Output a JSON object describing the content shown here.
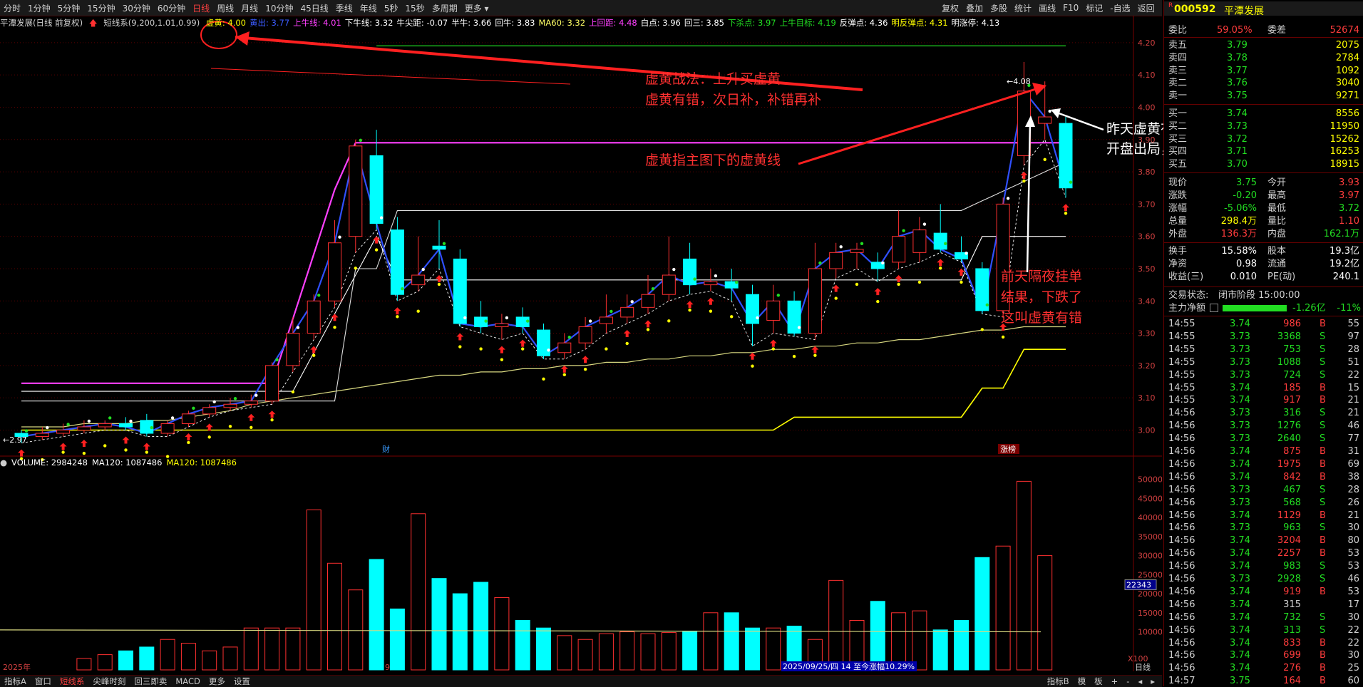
{
  "top_nav": {
    "items": [
      "分时",
      "1分钟",
      "5分钟",
      "15分钟",
      "30分钟",
      "60分钟",
      "日线",
      "周线",
      "月线",
      "10分钟",
      "45日线",
      "季线",
      "年线",
      "5秒",
      "15秒",
      "多周期",
      "更多 ▾"
    ],
    "active": "日线",
    "right_buttons": [
      "复权",
      "叠加",
      "多股",
      "统计",
      "画线",
      "F10",
      "标记",
      "-自选",
      "返回"
    ]
  },
  "chart_header": {
    "stock_title": "平潭发展(日线 前复权)",
    "indicator_name": "短线系(9,200,1.01,0.99)",
    "indicators": [
      {
        "label": "虚黄:",
        "value": "4.00",
        "color": "#ffff00"
      },
      {
        "label": "黄出:",
        "value": "3.77",
        "color": "#3b5bff"
      },
      {
        "label": "上牛线:",
        "value": "4.01",
        "color": "#ff40ff"
      },
      {
        "label": "下牛线:",
        "value": "3.32",
        "color": "#ffffff"
      },
      {
        "label": "牛尖距:",
        "value": "-0.07",
        "color": "#ffffff"
      },
      {
        "label": "半牛:",
        "value": "3.66",
        "color": "#ffffff"
      },
      {
        "label": "回牛:",
        "value": "3.83",
        "color": "#ffffff"
      },
      {
        "label": "MA60:",
        "value": "3.32",
        "color": "#ffff66"
      },
      {
        "label": "上回距:",
        "value": "4.48",
        "color": "#ff40ff"
      },
      {
        "label": "白点:",
        "value": "3.96",
        "color": "#ffffff"
      },
      {
        "label": "回三:",
        "value": "3.85",
        "color": "#ffffff"
      },
      {
        "label": "下杀点:",
        "value": "3.97",
        "color": "#22dd22"
      },
      {
        "label": "上牛目标:",
        "value": "4.19",
        "color": "#22dd22"
      },
      {
        "label": "反弹点:",
        "value": "4.36",
        "color": "#ffffff"
      },
      {
        "label": "明反弹点:",
        "value": "4.31",
        "color": "#ffff00"
      },
      {
        "label": "明涨停:",
        "value": "4.13",
        "color": "#ffffff"
      }
    ],
    "cai_label": "财",
    "zhangting_label": "涨榜"
  },
  "volume_header": {
    "items": [
      {
        "label": "VOLUME:",
        "value": "2984248",
        "color": "#ffffff"
      },
      {
        "label": "MA120:",
        "value": "1087486",
        "color": "#ffffff"
      },
      {
        "label": "MA120:",
        "value": "1087486",
        "color": "#ffff00"
      }
    ],
    "x100": "X100",
    "current_tag": "22343"
  },
  "annotations": {
    "red1_line1": "虚黄战法：上升买虚黄",
    "red1_line2": "虚黄有错，次日补，补错再补",
    "red2": "虚黄指主图下的虚黄线",
    "red3_line1": "前天隔夜挂单",
    "red3_line2": "结果，下跌了",
    "red3_line3": "这叫虚黄有错",
    "white_line1": "昨天虚黄有错，今天先出后补",
    "white_line2": "开盘出局，尾盘接回",
    "start_price": "2.97",
    "peak_price": "4.08"
  },
  "axis": {
    "price_ticks": [
      "4.20",
      "4.10",
      "4.00",
      "3.90",
      "3.80",
      "3.70",
      "3.60",
      "3.50",
      "3.40",
      "3.30",
      "3.20",
      "3.10",
      "3.00"
    ],
    "vol_ticks": [
      "50000",
      "45000",
      "40000",
      "35000",
      "30000",
      "25000",
      "20000",
      "15000",
      "10000"
    ],
    "x_left": "2025年",
    "x_mid": "9",
    "range_info": "2025/09/25/四 14 至今涨幅10.29%",
    "right_tag": "日线"
  },
  "bottom_bar": {
    "items": [
      "指标A",
      "窗口",
      "短线系",
      "尖峰时刻",
      "回三即卖",
      "MACD",
      "更多",
      "设置"
    ],
    "active": "短线系",
    "right_items": [
      "指标B",
      "模",
      "板",
      "+",
      "-",
      "◂",
      "▸"
    ]
  },
  "chart_data": {
    "type": "candlestick",
    "candles": [
      {
        "o": 2.99,
        "c": 2.98,
        "h": 3.0,
        "l": 2.96
      },
      {
        "o": 2.98,
        "c": 2.99,
        "h": 3.01,
        "l": 2.97
      },
      {
        "o": 2.99,
        "c": 3.0,
        "h": 3.02,
        "l": 2.98
      },
      {
        "o": 3.0,
        "c": 3.01,
        "h": 3.03,
        "l": 2.99
      },
      {
        "o": 3.01,
        "c": 3.02,
        "h": 3.03,
        "l": 3.0
      },
      {
        "o": 3.02,
        "c": 3.01,
        "h": 3.04,
        "l": 3.0
      },
      {
        "o": 3.03,
        "c": 2.99,
        "h": 3.05,
        "l": 2.98
      },
      {
        "o": 2.99,
        "c": 3.02,
        "h": 3.03,
        "l": 2.98
      },
      {
        "o": 3.02,
        "c": 3.05,
        "h": 3.06,
        "l": 3.01
      },
      {
        "o": 3.05,
        "c": 3.07,
        "h": 3.08,
        "l": 3.04
      },
      {
        "o": 3.07,
        "c": 3.08,
        "h": 3.1,
        "l": 3.06
      },
      {
        "o": 3.08,
        "c": 3.09,
        "h": 3.11,
        "l": 3.07
      },
      {
        "o": 3.09,
        "c": 3.2,
        "h": 3.21,
        "l": 3.08
      },
      {
        "o": 3.2,
        "c": 3.3,
        "h": 3.35,
        "l": 3.18
      },
      {
        "o": 3.3,
        "c": 3.4,
        "h": 3.42,
        "l": 3.28
      },
      {
        "o": 3.4,
        "c": 3.58,
        "h": 3.65,
        "l": 3.38
      },
      {
        "o": 3.6,
        "c": 3.88,
        "h": 3.9,
        "l": 3.55
      },
      {
        "o": 3.85,
        "c": 3.64,
        "h": 3.93,
        "l": 3.62
      },
      {
        "o": 3.62,
        "c": 3.42,
        "h": 3.66,
        "l": 3.4
      },
      {
        "o": 3.45,
        "c": 3.48,
        "h": 3.6,
        "l": 3.43
      },
      {
        "o": 3.57,
        "c": 3.56,
        "h": 3.65,
        "l": 3.5
      },
      {
        "o": 3.53,
        "c": 3.33,
        "h": 3.56,
        "l": 3.32
      },
      {
        "o": 3.35,
        "c": 3.32,
        "h": 3.4,
        "l": 3.3
      },
      {
        "o": 3.32,
        "c": 3.33,
        "h": 3.36,
        "l": 3.28
      },
      {
        "o": 3.35,
        "c": 3.32,
        "h": 3.38,
        "l": 3.3
      },
      {
        "o": 3.31,
        "c": 3.23,
        "h": 3.33,
        "l": 3.22
      },
      {
        "o": 3.24,
        "c": 3.27,
        "h": 3.3,
        "l": 3.22
      },
      {
        "o": 3.27,
        "c": 3.32,
        "h": 3.35,
        "l": 3.25
      },
      {
        "o": 3.33,
        "c": 3.35,
        "h": 3.42,
        "l": 3.3
      },
      {
        "o": 3.35,
        "c": 3.38,
        "h": 3.42,
        "l": 3.33
      },
      {
        "o": 3.38,
        "c": 3.42,
        "h": 3.48,
        "l": 3.36
      },
      {
        "o": 3.42,
        "c": 3.48,
        "h": 3.6,
        "l": 3.4
      },
      {
        "o": 3.53,
        "c": 3.45,
        "h": 3.58,
        "l": 3.42
      },
      {
        "o": 3.45,
        "c": 3.46,
        "h": 3.5,
        "l": 3.43
      },
      {
        "o": 3.46,
        "c": 3.44,
        "h": 3.5,
        "l": 3.4
      },
      {
        "o": 3.42,
        "c": 3.33,
        "h": 3.45,
        "l": 3.26
      },
      {
        "o": 3.34,
        "c": 3.4,
        "h": 3.45,
        "l": 3.3
      },
      {
        "o": 3.4,
        "c": 3.3,
        "h": 3.43,
        "l": 3.29
      },
      {
        "o": 3.3,
        "c": 3.5,
        "h": 3.58,
        "l": 3.28
      },
      {
        "o": 3.5,
        "c": 3.55,
        "h": 3.58,
        "l": 3.47
      },
      {
        "o": 3.55,
        "c": 3.56,
        "h": 3.58,
        "l": 3.5
      },
      {
        "o": 3.52,
        "c": 3.5,
        "h": 3.55,
        "l": 3.46
      },
      {
        "o": 3.52,
        "c": 3.6,
        "h": 3.68,
        "l": 3.5
      },
      {
        "o": 3.55,
        "c": 3.62,
        "h": 3.66,
        "l": 3.52
      },
      {
        "o": 3.61,
        "c": 3.56,
        "h": 3.7,
        "l": 3.55
      },
      {
        "o": 3.55,
        "c": 3.53,
        "h": 3.6,
        "l": 3.52
      },
      {
        "o": 3.5,
        "c": 3.37,
        "h": 3.52,
        "l": 3.36
      },
      {
        "o": 3.37,
        "c": 3.7,
        "h": 3.72,
        "l": 3.35
      },
      {
        "o": 3.85,
        "c": 4.05,
        "h": 4.14,
        "l": 3.82
      },
      {
        "o": 3.95,
        "c": 3.97,
        "h": 4.08,
        "l": 3.9
      },
      {
        "o": 3.95,
        "c": 3.75,
        "h": 3.97,
        "l": 3.72
      }
    ],
    "volume": [
      3000,
      4000,
      5000,
      6000,
      8000,
      7000,
      5000,
      6000,
      11000,
      11000,
      11000,
      42000,
      28000,
      21000,
      29000,
      16000,
      41000,
      24000,
      20000,
      23000,
      19000,
      13000,
      11000,
      9000,
      8000,
      9500,
      10000,
      9500,
      9800,
      10200,
      15000,
      15000,
      11000,
      11000,
      11500,
      8000,
      23500,
      13000,
      18000,
      15000,
      15500,
      10500,
      13000,
      29500,
      32500,
      49500,
      30000
    ],
    "ma60": [
      3.01,
      3.01,
      3.01,
      3.02,
      3.02,
      3.02,
      3.03,
      3.03,
      3.04,
      3.05,
      3.06,
      3.08,
      3.09,
      3.1,
      3.11,
      3.12,
      3.13,
      3.14,
      3.15,
      3.16,
      3.17,
      3.17,
      3.18,
      3.18,
      3.19,
      3.19,
      3.2,
      3.2,
      3.21,
      3.21,
      3.22,
      3.22,
      3.23,
      3.23,
      3.24,
      3.24,
      3.25,
      3.25,
      3.26,
      3.26,
      3.27,
      3.27,
      3.28,
      3.28,
      3.29,
      3.3,
      3.31,
      3.31,
      3.32,
      3.32,
      3.32
    ]
  },
  "quote_panel": {
    "code": "000592",
    "name": "平潭发展",
    "weibi_label": "委比",
    "weibi": "59.05%",
    "weicha_label": "委差",
    "weicha": "52674",
    "sell": [
      {
        "label": "卖五",
        "price": "3.79",
        "vol": "2075"
      },
      {
        "label": "卖四",
        "price": "3.78",
        "vol": "2784"
      },
      {
        "label": "卖三",
        "price": "3.77",
        "vol": "1092"
      },
      {
        "label": "卖二",
        "price": "3.76",
        "vol": "3040"
      },
      {
        "label": "卖一",
        "price": "3.75",
        "vol": "9271"
      }
    ],
    "buy": [
      {
        "label": "买一",
        "price": "3.74",
        "vol": "8556"
      },
      {
        "label": "买二",
        "price": "3.73",
        "vol": "11950"
      },
      {
        "label": "买三",
        "price": "3.72",
        "vol": "15262"
      },
      {
        "label": "买四",
        "price": "3.71",
        "vol": "16253"
      },
      {
        "label": "买五",
        "price": "3.70",
        "vol": "18915"
      }
    ],
    "stats": [
      {
        "l1": "现价",
        "v1": "3.75",
        "c1": "green",
        "l2": "今开",
        "v2": "3.93",
        "c2": "red"
      },
      {
        "l1": "涨跌",
        "v1": "-0.20",
        "c1": "green",
        "l2": "最高",
        "v2": "3.97",
        "c2": "red"
      },
      {
        "l1": "涨幅",
        "v1": "-5.06%",
        "c1": "green",
        "l2": "最低",
        "v2": "3.72",
        "c2": "green"
      },
      {
        "l1": "总量",
        "v1": "298.4万",
        "c1": "yellow",
        "l2": "量比",
        "v2": "1.10",
        "c2": "red"
      },
      {
        "l1": "外盘",
        "v1": "136.3万",
        "c1": "red",
        "l2": "内盘",
        "v2": "162.1万",
        "c2": "green"
      },
      {
        "l1": "换手",
        "v1": "15.58%",
        "c1": "white",
        "l2": "股本",
        "v2": "19.3亿",
        "c2": "white"
      },
      {
        "l1": "净资",
        "v1": "0.98",
        "c1": "white",
        "l2": "流通",
        "v2": "19.2亿",
        "c2": "white"
      },
      {
        "l1": "收益(三)",
        "v1": "0.010",
        "c1": "white",
        "l2": "PE(动)",
        "v2": "240.1",
        "c2": "white"
      }
    ],
    "trade_status_label": "交易状态:",
    "trade_status": "闭市阶段 15:00:00",
    "main_net_label": "主力净额",
    "main_net": "-1.26亿",
    "main_net_pct": "-11%",
    "ticks": [
      {
        "t": "14:55",
        "p": "3.74",
        "v": "986",
        "bs": "B",
        "n": "55"
      },
      {
        "t": "14:55",
        "p": "3.73",
        "v": "3368",
        "bs": "S",
        "n": "97"
      },
      {
        "t": "14:55",
        "p": "3.73",
        "v": "753",
        "bs": "S",
        "n": "28"
      },
      {
        "t": "14:55",
        "p": "3.73",
        "v": "1088",
        "bs": "S",
        "n": "51"
      },
      {
        "t": "14:55",
        "p": "3.73",
        "v": "724",
        "bs": "S",
        "n": "22"
      },
      {
        "t": "14:55",
        "p": "3.74",
        "v": "185",
        "bs": "B",
        "n": "15"
      },
      {
        "t": "14:55",
        "p": "3.74",
        "v": "917",
        "bs": "B",
        "n": "21"
      },
      {
        "t": "14:56",
        "p": "3.73",
        "v": "316",
        "bs": "S",
        "n": "21"
      },
      {
        "t": "14:56",
        "p": "3.73",
        "v": "1276",
        "bs": "S",
        "n": "46"
      },
      {
        "t": "14:56",
        "p": "3.73",
        "v": "2640",
        "bs": "S",
        "n": "77"
      },
      {
        "t": "14:56",
        "p": "3.74",
        "v": "875",
        "bs": "B",
        "n": "31"
      },
      {
        "t": "14:56",
        "p": "3.74",
        "v": "1975",
        "bs": "B",
        "n": "69"
      },
      {
        "t": "14:56",
        "p": "3.74",
        "v": "842",
        "bs": "B",
        "n": "38"
      },
      {
        "t": "14:56",
        "p": "3.73",
        "v": "467",
        "bs": "S",
        "n": "28"
      },
      {
        "t": "14:56",
        "p": "3.73",
        "v": "568",
        "bs": "S",
        "n": "26"
      },
      {
        "t": "14:56",
        "p": "3.74",
        "v": "1129",
        "bs": "B",
        "n": "21"
      },
      {
        "t": "14:56",
        "p": "3.73",
        "v": "963",
        "bs": "S",
        "n": "30"
      },
      {
        "t": "14:56",
        "p": "3.74",
        "v": "3204",
        "bs": "B",
        "n": "80"
      },
      {
        "t": "14:56",
        "p": "3.74",
        "v": "2257",
        "bs": "B",
        "n": "53"
      },
      {
        "t": "14:56",
        "p": "3.74",
        "v": "983",
        "bs": "S",
        "n": "53"
      },
      {
        "t": "14:56",
        "p": "3.73",
        "v": "2928",
        "bs": "S",
        "n": "46"
      },
      {
        "t": "14:56",
        "p": "3.74",
        "v": "919",
        "bs": "B",
        "n": "53"
      },
      {
        "t": "14:56",
        "p": "3.74",
        "v": "315",
        "bs": "",
        "n": "17"
      },
      {
        "t": "14:56",
        "p": "3.74",
        "v": "732",
        "bs": "S",
        "n": "30"
      },
      {
        "t": "14:56",
        "p": "3.74",
        "v": "313",
        "bs": "S",
        "n": "22"
      },
      {
        "t": "14:56",
        "p": "3.74",
        "v": "833",
        "bs": "B",
        "n": "22"
      },
      {
        "t": "14:56",
        "p": "3.74",
        "v": "699",
        "bs": "B",
        "n": "30"
      },
      {
        "t": "14:56",
        "p": "3.74",
        "v": "276",
        "bs": "B",
        "n": "25"
      },
      {
        "t": "14:57",
        "p": "3.75",
        "v": "164",
        "bs": "B",
        "n": "60"
      }
    ]
  }
}
